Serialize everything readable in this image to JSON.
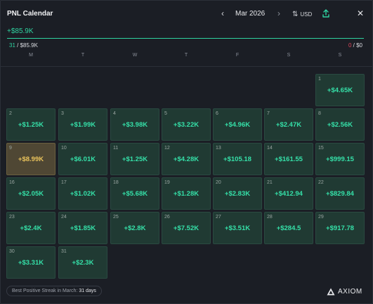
{
  "header": {
    "title": "PNL Calendar",
    "month": "Mar 2026",
    "currency": "USD",
    "prev_glyph": "‹",
    "next_glyph": "›",
    "close_glyph": "✕"
  },
  "summary": {
    "total": "+$85.9K",
    "positive_days": "31",
    "positive_total": "/ $85.9K",
    "negative_days": "0",
    "negative_total": "/ $0",
    "progress_positive_fraction": 1.0
  },
  "weekdays": [
    "M",
    "T",
    "W",
    "T",
    "F",
    "S",
    "S"
  ],
  "days": [
    {
      "day": "1",
      "value": "+$4.65K"
    },
    {
      "day": "2",
      "value": "+$1.25K"
    },
    {
      "day": "3",
      "value": "+$1.99K"
    },
    {
      "day": "4",
      "value": "+$3.98K"
    },
    {
      "day": "5",
      "value": "+$3.22K"
    },
    {
      "day": "6",
      "value": "+$4.96K"
    },
    {
      "day": "7",
      "value": "+$2.47K"
    },
    {
      "day": "8",
      "value": "+$2.56K"
    },
    {
      "day": "9",
      "value": "+$8.99K",
      "highlight": true
    },
    {
      "day": "10",
      "value": "+$6.01K"
    },
    {
      "day": "11",
      "value": "+$1.25K"
    },
    {
      "day": "12",
      "value": "+$4.28K"
    },
    {
      "day": "13",
      "value": "+$105.18"
    },
    {
      "day": "14",
      "value": "+$161.55"
    },
    {
      "day": "15",
      "value": "+$999.15"
    },
    {
      "day": "16",
      "value": "+$2.05K"
    },
    {
      "day": "17",
      "value": "+$1.02K"
    },
    {
      "day": "18",
      "value": "+$5.68K"
    },
    {
      "day": "19",
      "value": "+$1.28K"
    },
    {
      "day": "20",
      "value": "+$2.83K"
    },
    {
      "day": "21",
      "value": "+$412.94"
    },
    {
      "day": "22",
      "value": "+$829.84"
    },
    {
      "day": "23",
      "value": "+$2.4K"
    },
    {
      "day": "24",
      "value": "+$1.85K"
    },
    {
      "day": "25",
      "value": "+$2.8K"
    },
    {
      "day": "26",
      "value": "+$7.52K"
    },
    {
      "day": "27",
      "value": "+$3.51K"
    },
    {
      "day": "28",
      "value": "+$284.5"
    },
    {
      "day": "29",
      "value": "+$917.78"
    },
    {
      "day": "30",
      "value": "+$3.31K"
    },
    {
      "day": "31",
      "value": "+$2.3K"
    }
  ],
  "footer": {
    "streak_label": "Best Positive Streak in March:",
    "streak_value": "31 days",
    "brand": "AXIOM"
  },
  "colors": {
    "positive": "#2fd3a0",
    "negative": "#e0455a",
    "highlight": "#eac35c",
    "background": "#1b1e25"
  },
  "icons": {
    "prev": "chevron-left-icon",
    "next": "chevron-right-icon",
    "swap": "swap-vertical-icon",
    "export": "share-upload-icon",
    "close": "close-icon",
    "brand": "axiom-logo-icon"
  }
}
